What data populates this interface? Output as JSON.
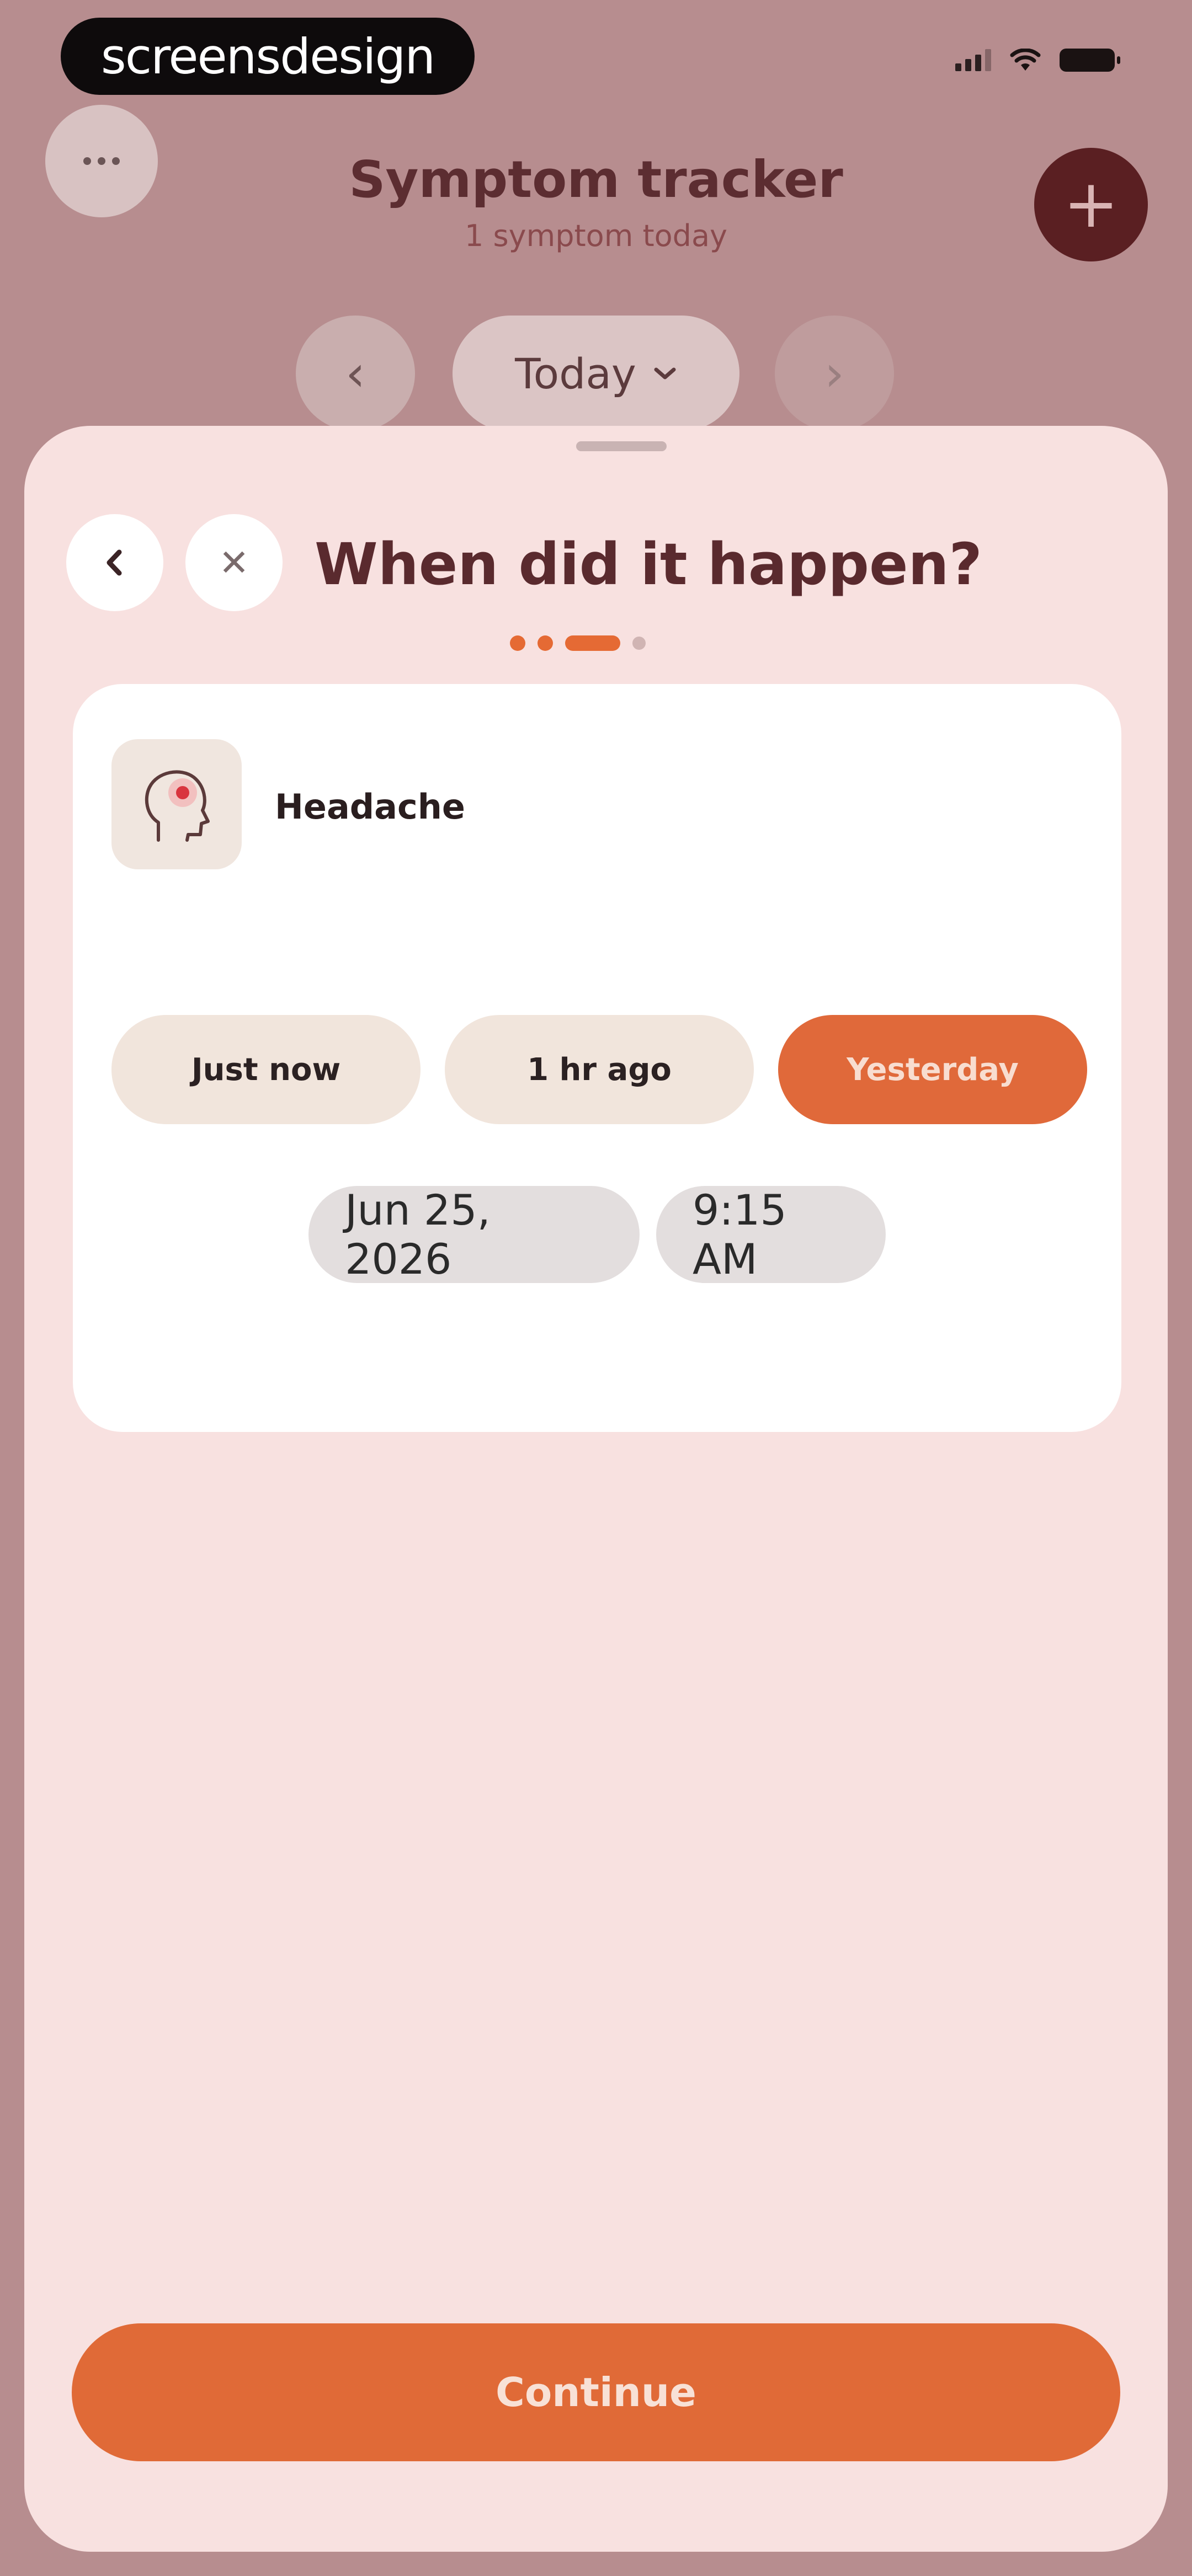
{
  "status_bar": {
    "watermark": "screensdesign",
    "signal_icon": "cellular-signal-icon",
    "wifi_icon": "wifi-icon",
    "battery_icon": "battery-icon"
  },
  "header": {
    "title": "Symptom tracker",
    "subtitle": "1 symptom today",
    "more_icon": "more-horizontal-icon",
    "add_icon": "plus-icon",
    "add_glyph": "+"
  },
  "day_nav": {
    "prev_glyph": "‹",
    "next_glyph": "›",
    "label": "Today",
    "chevron_glyph": "⌄"
  },
  "sheet": {
    "back_glyph": "‹",
    "close_glyph": "✕",
    "title": "When did it happen?",
    "progress": {
      "total_steps": 4,
      "current_step": 3
    },
    "symptom": {
      "name": "Headache",
      "icon": "headache-head-icon"
    },
    "quick_options": [
      {
        "label": "Just now",
        "selected": false
      },
      {
        "label": "1 hr ago",
        "selected": false
      },
      {
        "label": "Yesterday",
        "selected": true
      }
    ],
    "date_value": "Jun 25, 2026",
    "time_value": "9:15 AM",
    "continue_label": "Continue"
  },
  "colors": {
    "accent": "#e0693a",
    "background": "#b78d8f",
    "sheet": "#f8e1e0",
    "title": "#5a2a2e"
  }
}
